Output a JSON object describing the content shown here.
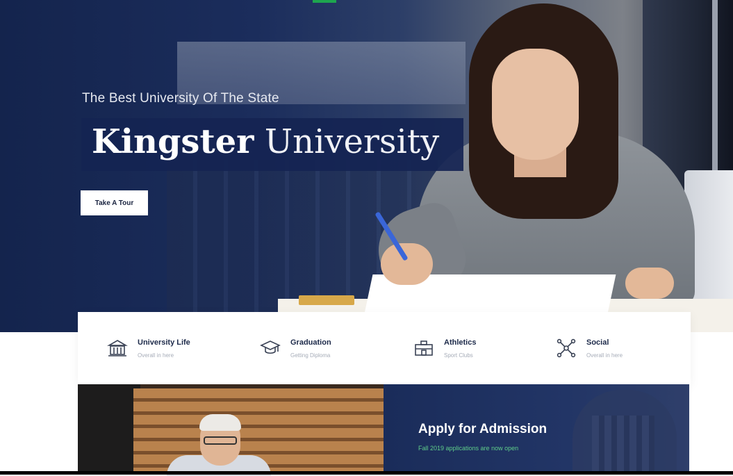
{
  "hero": {
    "tagline": "The Best University Of The State",
    "title_bold": "Kingster",
    "title_light": "University",
    "cta_label": "Take A Tour"
  },
  "features": [
    {
      "title": "University Life",
      "subtitle": "Overall in here",
      "icon": "university-building-icon"
    },
    {
      "title": "Graduation",
      "subtitle": "Getting Diploma",
      "icon": "graduation-cap-icon"
    },
    {
      "title": "Athletics",
      "subtitle": "Sport Clubs",
      "icon": "stadium-icon"
    },
    {
      "title": "Social",
      "subtitle": "Overall in here",
      "icon": "social-network-icon"
    }
  ],
  "admission": {
    "title": "Apply for Admission",
    "subtitle": "Fall 2019 applications are now open"
  },
  "colors": {
    "navy": "#152452",
    "accent_green": "#5fce8a",
    "white": "#ffffff"
  }
}
